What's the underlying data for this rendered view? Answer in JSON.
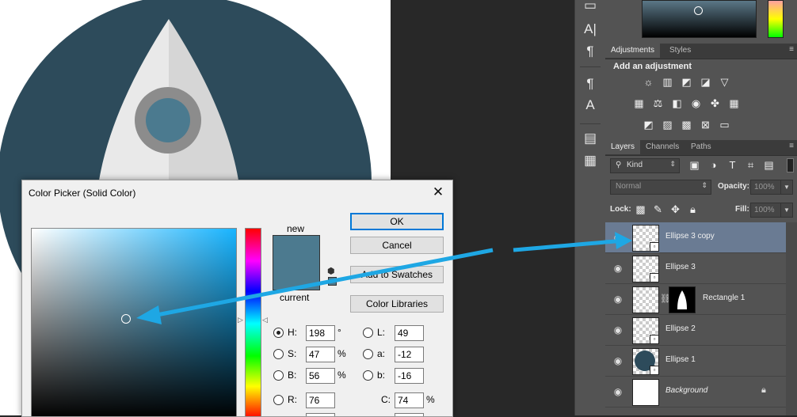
{
  "colors": {
    "circle_fill": "#2d4b5b",
    "rocket_light": "#e9e9e9",
    "rocket_shade": "#d6d6d6",
    "window_ring": "#8c8c8c",
    "window_fill": "#4b7a8f",
    "selected_color": "#4c7a8f",
    "arrow": "#1ea7e4",
    "layer_selected": "#6a7b93"
  },
  "tools": [
    {
      "icon": "type-tool-icon",
      "glyph": "A|"
    },
    {
      "icon": "paragraph-icon",
      "glyph": "¶"
    },
    {
      "icon": "paragraph-styles-icon",
      "glyph": "¶"
    },
    {
      "icon": "character-styles-icon",
      "glyph": "A"
    },
    {
      "icon": "notes-icon",
      "glyph": "▤"
    },
    {
      "icon": "properties-icon",
      "glyph": "▦"
    }
  ],
  "adjustments": {
    "tabs": [
      "Adjustments",
      "Styles"
    ],
    "heading": "Add an adjustment"
  },
  "layers_panel": {
    "tabs": [
      "Layers",
      "Channels",
      "Paths"
    ],
    "filter_kind": "Kind",
    "blend_mode": "Normal",
    "opacity_label": "Opacity:",
    "opacity_value": "100%",
    "lock_label": "Lock:",
    "fill_label": "Fill:",
    "fill_value": "100%",
    "layers": [
      {
        "name": "Ellipse 3 copy",
        "selected": true
      },
      {
        "name": "Ellipse 3",
        "selected": false
      },
      {
        "name": "Rectangle 1",
        "selected": false
      },
      {
        "name": "Ellipse 2",
        "selected": false
      },
      {
        "name": "Ellipse 1",
        "selected": false
      },
      {
        "name": "Background",
        "selected": false
      }
    ]
  },
  "color_picker": {
    "title": "Color Picker (Solid Color)",
    "close_glyph": "✕",
    "new_label": "new",
    "current_label": "current",
    "ok_label": "OK",
    "cancel_label": "Cancel",
    "swatches_label": "Add to Swatches",
    "libraries_label": "Color Libraries",
    "fields": {
      "H": {
        "label": "H:",
        "value": "198",
        "unit": "°"
      },
      "S": {
        "label": "S:",
        "value": "47",
        "unit": "%"
      },
      "B": {
        "label": "B:",
        "value": "56",
        "unit": "%"
      },
      "R": {
        "label": "R:",
        "value": "76"
      },
      "L": {
        "label": "L:",
        "value": "49"
      },
      "a": {
        "label": "a:",
        "value": "-12"
      },
      "b": {
        "label": "b:",
        "value": "-16"
      },
      "C": {
        "label": "C:",
        "value": "74",
        "unit": "%"
      }
    }
  }
}
